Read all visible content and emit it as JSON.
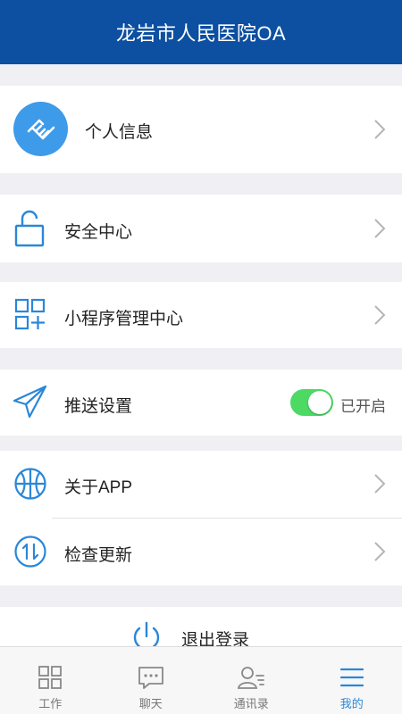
{
  "header": {
    "title": "龙岩市人民医院OA"
  },
  "profile": {
    "label": "个人信息",
    "icon": "handshake-icon",
    "avatar_color": "#3d9be9"
  },
  "security": {
    "label": "安全中心",
    "icon": "lock-icon"
  },
  "miniprogram": {
    "label": "小程序管理中心",
    "icon": "grid-plus-icon"
  },
  "push": {
    "label": "推送设置",
    "icon": "paper-plane-icon",
    "enabled": true,
    "status": "已开启"
  },
  "about": {
    "label": "关于APP",
    "icon": "basketball-icon"
  },
  "update": {
    "label": "检查更新",
    "icon": "sync-arrows-icon"
  },
  "logout": {
    "label": "退出登录",
    "icon": "power-icon"
  },
  "tabbar": {
    "items": [
      {
        "label": "工作",
        "icon": "grid-icon",
        "active": false
      },
      {
        "label": "聊天",
        "icon": "chat-icon",
        "active": false
      },
      {
        "label": "通讯录",
        "icon": "contacts-icon",
        "active": false
      },
      {
        "label": "我的",
        "icon": "menu-icon",
        "active": true
      }
    ]
  },
  "colors": {
    "brand": "#0d4fa0",
    "accent": "#2a87d8",
    "toggle_on": "#4cd964",
    "background": "#efeff4"
  }
}
